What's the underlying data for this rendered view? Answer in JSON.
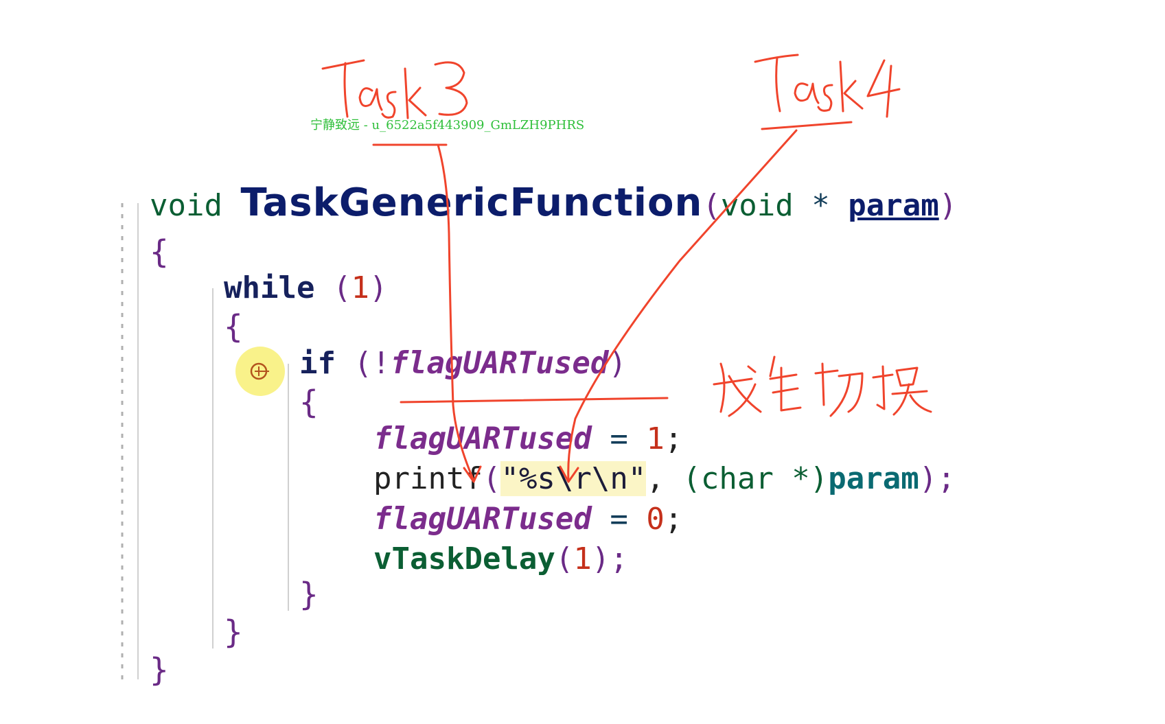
{
  "watermark": "宁静致远 - u_6522a5f443909_GmLZH9PHRS",
  "code": {
    "l1": {
      "ret": "void",
      "name": "TaskGenericFunction",
      "open": "(",
      "ptype": "void",
      "star": " * ",
      "param": "param",
      "close": ")"
    },
    "l2": "{",
    "l3": {
      "kw": "while",
      "open": " (",
      "num": "1",
      "close": ")"
    },
    "l4": "{",
    "l5": {
      "kw": "if",
      "open": " (!",
      "var": "flagUARTused",
      "close": ")"
    },
    "l6": "{",
    "l7": {
      "var": "flagUARTused",
      "op": " = ",
      "num": "1",
      "semi": ";"
    },
    "l8": {
      "fn": "printf",
      "open": "(",
      "str": "\"%s\\r\\n\"",
      "comma": ", ",
      "cast": "(char *)",
      "param": "param",
      "close": ");"
    },
    "l9": {
      "var": "flagUARTused",
      "op": " = ",
      "num": "0",
      "semi": ";"
    },
    "l10": {
      "fn": "vTaskDelay",
      "open": "(",
      "num": "1",
      "close": ");"
    },
    "l11": "}",
    "l12": "}",
    "l13": "}"
  },
  "annotations": {
    "task3": "Task3",
    "task4": "Task4",
    "switch_note": "发生切换",
    "ink_color": "#f0442c"
  },
  "cursor_icon": "crosshair-cursor-icon"
}
